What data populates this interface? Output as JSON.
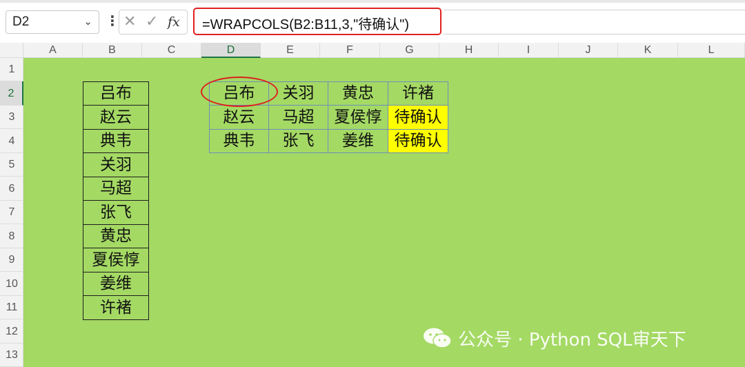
{
  "name_box": {
    "value": "D2"
  },
  "formula": {
    "value": "=WRAPCOLS(B2:B11,3,\"待确认\")"
  },
  "icons": {
    "cancel": "close-icon",
    "enter": "check-icon",
    "fx": "fx-icon",
    "chevron": "chevron-down-icon",
    "more": "more-vertical-icon"
  },
  "fx_label": "fx",
  "columns": [
    "A",
    "B",
    "C",
    "D",
    "E",
    "F",
    "G",
    "H",
    "I",
    "J",
    "K",
    "L"
  ],
  "rows": [
    "1",
    "2",
    "3",
    "4",
    "5",
    "6",
    "7",
    "8",
    "9",
    "10",
    "11",
    "12",
    "13"
  ],
  "selected": {
    "column": "D",
    "row": "2"
  },
  "source_list": [
    "吕布",
    "赵云",
    "典韦",
    "关羽",
    "马超",
    "张飞",
    "黄忠",
    "夏侯惇",
    "姜维",
    "许褚"
  ],
  "output": [
    [
      "吕布",
      "关羽",
      "黄忠",
      "许褚"
    ],
    [
      "赵云",
      "马超",
      "夏侯惇",
      "待确认"
    ],
    [
      "典韦",
      "张飞",
      "姜维",
      "待确认"
    ]
  ],
  "colors": {
    "sheet_bg": "#a4d964",
    "highlight": "#ffff00",
    "accent_red": "#e02020",
    "selection_green": "#1e7145"
  },
  "watermark": {
    "text": "公众号 · Python SQL审天下"
  }
}
